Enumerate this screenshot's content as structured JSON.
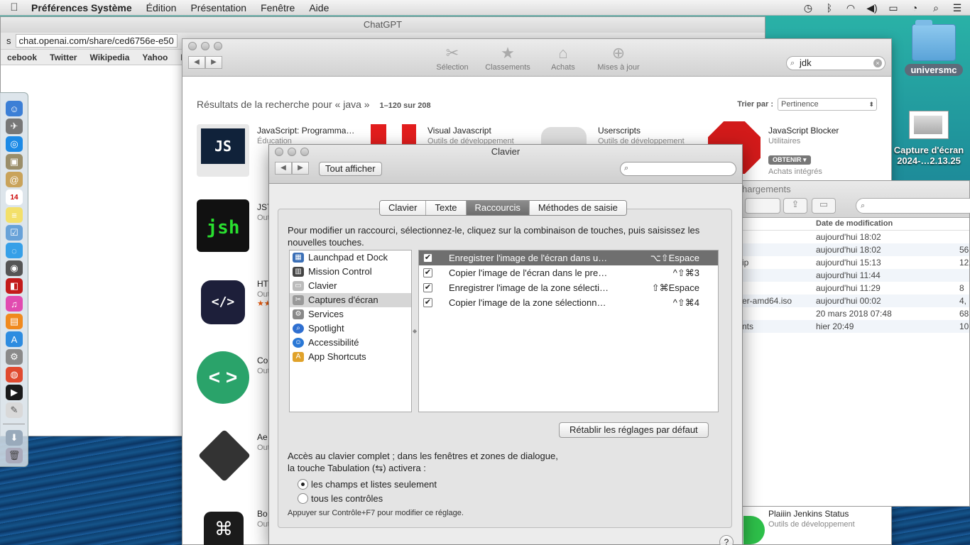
{
  "menubar": {
    "app": "Préférences Système",
    "menus": [
      "Édition",
      "Présentation",
      "Fenêtre",
      "Aide"
    ],
    "status_icons": [
      "time-machine-icon",
      "bluetooth-icon",
      "wifi-icon",
      "volume-icon",
      "battery-icon",
      "clock-icon",
      "spotlight-icon",
      "notification-center-icon"
    ]
  },
  "desktop": {
    "folder": "universmc",
    "screenshot_label_1": "Capture d'écran",
    "screenshot_label_2": "2024-…2.13.25"
  },
  "chrome": {
    "title": "ChatGPT",
    "url": "chat.openai.com/share/ced6756e-e50",
    "url_prefix": "s",
    "bookmarks": [
      "cebook",
      "Twitter",
      "Wikipedia",
      "Yahoo",
      "Info"
    ]
  },
  "store": {
    "tabs": [
      "Sélection",
      "Classements",
      "Achats",
      "Mises à jour"
    ],
    "search_value": "jdk",
    "results_title": "Résultats de la recherche pour « java »",
    "results_range": "1–120 sur 208",
    "sort_label": "Trier par :",
    "sort_value": "Pertinence",
    "apps": [
      {
        "name": "JavaScript: Programma…",
        "cat": "Éducation",
        "btn": "OB",
        "extra": "Ach"
      },
      {
        "name": "Visual Javascript",
        "cat": "Outils de développement"
      },
      {
        "name": "Userscripts",
        "cat": "Outils de développement"
      },
      {
        "name": "JavaScript Blocker",
        "cat": "Utilitaires",
        "btn": "OBTENIR",
        "extra": "Achats intégrés"
      },
      {
        "name": "JST",
        "cat": "Out",
        "btn": "OB"
      },
      {
        "name": "HT",
        "cat": "Out",
        "btn": "OB",
        "stars": "★★"
      },
      {
        "name": "Co",
        "cat": "Out",
        "btn": "OB"
      },
      {
        "name": "Ae",
        "cat": "Out",
        "btn": "OB"
      },
      {
        "name": "Bo",
        "cat": "Out"
      },
      {
        "name": "Plaiiin Jenkins Status",
        "cat": "Outils de développement"
      }
    ],
    "icon_texts": {
      "js": "JS",
      "jsh": "jsh",
      "html": "</>",
      "code": "< >",
      "cmd": "⌘"
    }
  },
  "downloads": {
    "title": "hargements",
    "col_date": "Date de modification",
    "rows": [
      {
        "name": "",
        "date": "aujourd'hui 18:02",
        "size": ""
      },
      {
        "name": "",
        "date": "aujourd'hui 18:02",
        "size": "56"
      },
      {
        "name": "ip",
        "date": "aujourd'hui 15:13",
        "size": "12,"
      },
      {
        "name": "",
        "date": "aujourd'hui 11:44",
        "size": ""
      },
      {
        "name": "",
        "date": "aujourd'hui 11:29",
        "size": "8"
      },
      {
        "name": "er-amd64.iso",
        "date": "aujourd'hui 00:02",
        "size": "4,"
      },
      {
        "name": "",
        "date": "20 mars 2018 07:48",
        "size": "68"
      },
      {
        "name": "nts",
        "date": "hier 20:49",
        "size": "10"
      }
    ]
  },
  "clavier": {
    "title": "Clavier",
    "show_all": "Tout afficher",
    "search_placeholder": "",
    "tabs": [
      "Clavier",
      "Texte",
      "Raccourcis",
      "Méthodes de saisie"
    ],
    "active_tab": "Raccourcis",
    "instructions": "Pour modifier un raccourci, sélectionnez-le, cliquez sur la combinaison de touches, puis saisissez les nouvelles touches.",
    "categories": [
      {
        "label": "Launchpad et Dock",
        "icon": "launchpad-icon",
        "color": "#3b6fb6"
      },
      {
        "label": "Mission Control",
        "icon": "mission-control-icon",
        "color": "#444444"
      },
      {
        "label": "Clavier",
        "icon": "keyboard-icon",
        "color": "#bbbbbb"
      },
      {
        "label": "Captures d'écran",
        "icon": "screenshot-icon",
        "color": "#999999"
      },
      {
        "label": "Services",
        "icon": "services-gear-icon",
        "color": "#888888"
      },
      {
        "label": "Spotlight",
        "icon": "spotlight-icon",
        "color": "#2f6fd0"
      },
      {
        "label": "Accessibilité",
        "icon": "accessibility-icon",
        "color": "#2a78d6"
      },
      {
        "label": "App Shortcuts",
        "icon": "app-shortcuts-icon",
        "color": "#e0a22a"
      }
    ],
    "selected_category": 3,
    "shortcuts": [
      {
        "label": "Enregistrer l'image de l'écran dans u…",
        "key": "⌥⇧Espace",
        "checked": "✔"
      },
      {
        "label": "Copier l'image de l'écran dans le pre…",
        "key": "^⇧⌘3",
        "checked": "✔"
      },
      {
        "label": "Enregistrer l'image de la zone sélecti…",
        "key": "⇧⌘Espace",
        "checked": "✔"
      },
      {
        "label": "Copier l'image de la zone sélectionn…",
        "key": "^⇧⌘4",
        "checked": "✔"
      }
    ],
    "restore_button": "Rétablir les réglages par défaut",
    "access_line1": "Accès au clavier complet ; dans les fenêtres et zones de dialogue,",
    "access_line2": "la touche Tabulation (⇆) activera :",
    "radio_1": "les champs et listes seulement",
    "radio_2": "tous les contrôles",
    "note": "Appuyer sur Contrôle+F7 pour modifier ce réglage.",
    "help": "?"
  }
}
